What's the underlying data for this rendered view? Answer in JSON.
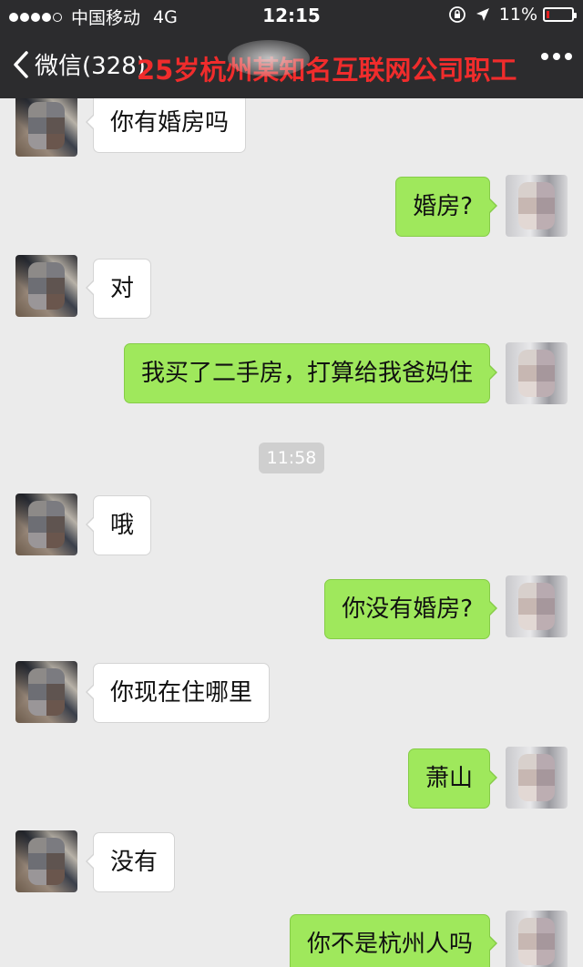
{
  "status_bar": {
    "carrier": "中国移动",
    "network": "4G",
    "time": "12:15",
    "battery_percent": "11%",
    "battery_level": 0.11,
    "battery_color": "#e02020",
    "icons": [
      "signal-dots-icon",
      "rotation-lock-icon",
      "location-arrow-icon",
      "battery-icon"
    ]
  },
  "nav": {
    "back_label": "微信(328)",
    "title": "25岁杭州某知名互联网公司职工",
    "title_color": "#f02c2c",
    "more_icon": "more-dots-icon"
  },
  "colors": {
    "background": "#ebebeb",
    "sent_bubble": "#9fe85c",
    "received_bubble": "#ffffff",
    "bar": "#2c2c2e"
  },
  "messages": [
    {
      "side": "left",
      "text": "你有婚房吗"
    },
    {
      "side": "right",
      "text": "婚房?"
    },
    {
      "side": "left",
      "text": "对"
    },
    {
      "side": "right",
      "text": "我买了二手房，打算给我爸妈住"
    },
    {
      "type": "time",
      "text": "11:58"
    },
    {
      "side": "left",
      "text": "哦"
    },
    {
      "side": "right",
      "text": "你没有婚房?"
    },
    {
      "side": "left",
      "text": "你现在住哪里"
    },
    {
      "side": "right",
      "text": "萧山"
    },
    {
      "side": "left",
      "text": "没有"
    },
    {
      "side": "right",
      "text": "你不是杭州人吗"
    }
  ]
}
